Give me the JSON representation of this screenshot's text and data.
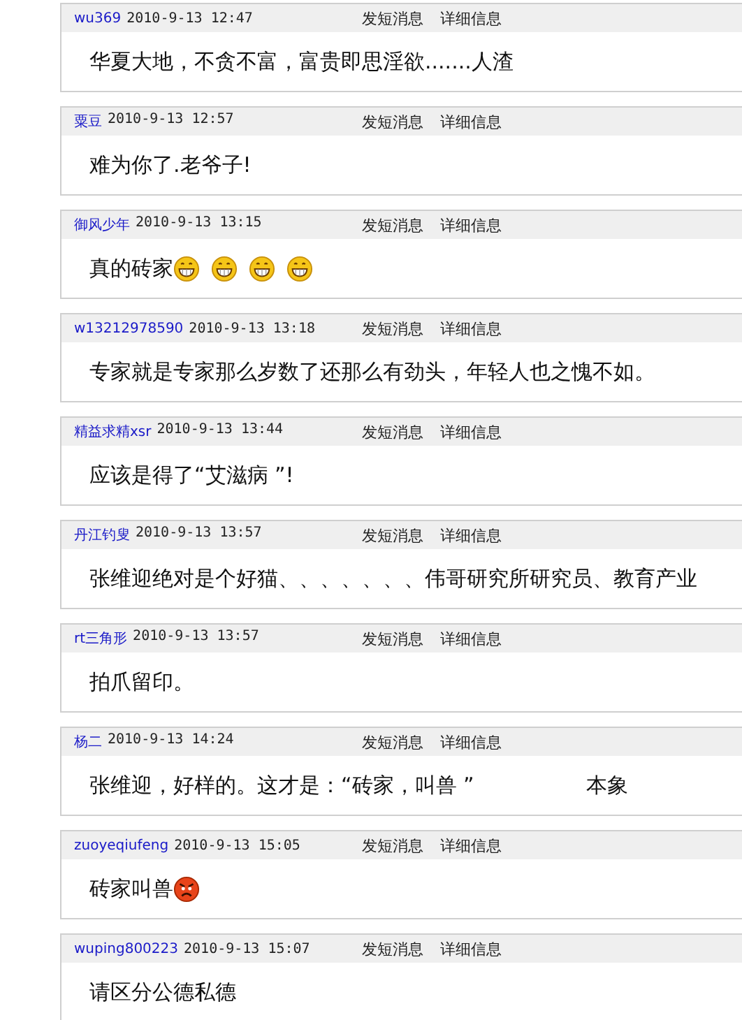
{
  "posts": [
    {
      "user": "wu369",
      "time": "2010-9-13 12:47",
      "actions": [
        "发短消息",
        "详细信息"
      ],
      "content": "华夏大地，不贪不富，富贵即思淫欲.......人渣"
    },
    {
      "user": "粟豆",
      "time": "2010-9-13 12:57",
      "actions": [
        "发短消息",
        "详细信息"
      ],
      "content": "难为你了.老爷子!"
    },
    {
      "user": "御风少年",
      "time": "2010-9-13 13:15",
      "actions": [
        "发短消息",
        "详细信息"
      ],
      "content": "真的砖家",
      "emoticons": [
        {
          "kind": "grin"
        },
        {
          "kind": "grin"
        },
        {
          "kind": "grin"
        },
        {
          "kind": "grin"
        }
      ]
    },
    {
      "user": "w13212978590",
      "time": "2010-9-13 13:18",
      "actions": [
        "发短消息",
        "详细信息"
      ],
      "content": "专家就是专家那么岁数了还那么有劲头，年轻人也之愧不如。"
    },
    {
      "user": "精益求精xsr",
      "time": "2010-9-13 13:44",
      "actions": [
        "发短消息",
        "详细信息"
      ],
      "content": "应该是得了“艾滋病 ”!"
    },
    {
      "user": "丹江钓叟",
      "time": "2010-9-13 13:57",
      "actions": [
        "发短消息",
        "详细信息"
      ],
      "content": "张维迎绝对是个好猫、、、、、、、伟哥研究所研究员、教育产业"
    },
    {
      "user": "rt三角形",
      "time": "2010-9-13 13:57",
      "actions": [
        "发短消息",
        "详细信息"
      ],
      "content": "拍爪留印。"
    },
    {
      "user": "杨二",
      "time": "2010-9-13 14:24",
      "actions": [
        "发短消息",
        "详细信息"
      ],
      "content": "张维迎，好样的。这才是：“砖家，叫兽 ”",
      "tail": "本象"
    },
    {
      "user": "zuoyeqiufeng",
      "time": "2010-9-13 15:05",
      "actions": [
        "发短消息",
        "详细信息"
      ],
      "content": "砖家叫兽",
      "emoticons": [
        {
          "kind": "angry"
        }
      ]
    },
    {
      "user": "wuping800223",
      "time": "2010-9-13 15:07",
      "actions": [
        "发短消息",
        "详细信息"
      ],
      "content": "请区分公德私德"
    }
  ]
}
